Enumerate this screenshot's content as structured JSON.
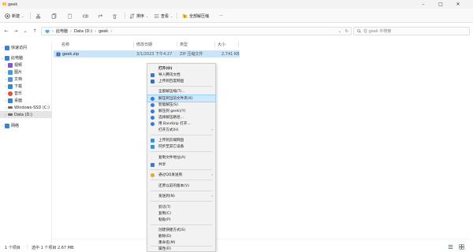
{
  "window": {
    "title": "geek"
  },
  "toolbar": {
    "new_label": "新建",
    "sort_label": "排序",
    "view_label": "查看",
    "extract_all_label": "全部解压缩",
    "more_label": "···"
  },
  "address": {
    "path": [
      "此电脑",
      "Data (D:)",
      "geek"
    ],
    "search_placeholder": "在 geek 中搜索"
  },
  "nav": {
    "items": [
      {
        "label": "快速访问",
        "color": "#3b82d6"
      },
      {
        "label": "此电脑",
        "color": "#3b82d6"
      },
      {
        "label": "视频",
        "color": "#7b5cd6"
      },
      {
        "label": "图片",
        "color": "#3aa0d8"
      },
      {
        "label": "文档",
        "color": "#5b8dd6"
      },
      {
        "label": "下载",
        "color": "#2f8ad6"
      },
      {
        "label": "音乐",
        "color": "#e0533b"
      },
      {
        "label": "桌面",
        "color": "#3a7fd6"
      },
      {
        "label": "Windows-SSD (C:)",
        "color": "#6b6b6b"
      },
      {
        "label": "Data (D:)",
        "color": "#6b6b6b"
      },
      {
        "label": "网络",
        "color": "#3b82d6"
      }
    ]
  },
  "columns": {
    "name": "名称",
    "modified": "修改日期",
    "type": "类型",
    "size": "大小"
  },
  "file": {
    "name": "geek.zip",
    "modified": "3/1/2023 下午4:27",
    "type": "ZIP 压缩文件",
    "size": "2,741 KB"
  },
  "context_menu": {
    "items": [
      {
        "label": "打开(O)",
        "bold": true
      },
      {
        "label": "导入腾讯文档",
        "icon_color": "#2f7be0"
      },
      {
        "label": "上传到百度网盘",
        "icon_color": "#2b6fd6"
      },
      {
        "label": "全部解压缩(T)..."
      },
      {
        "label": "解压到当前文件夹(X)",
        "icon_color": "#2f7be0",
        "highlight": true
      },
      {
        "label": "智能解压(S)",
        "icon_color": "#2f7be0"
      },
      {
        "label": "解压到 geek\\(Y)",
        "icon_color": "#2f7be0"
      },
      {
        "label": "选择解压路径...",
        "icon_color": "#2f7be0"
      },
      {
        "label": "用 Bandizip 打开...",
        "icon_color": "#2f7be0"
      },
      {
        "label": "打开方式(H)",
        "arrow": true
      },
      {
        "label": "上传到云端网盘",
        "icon_color": "#3b8fe0"
      },
      {
        "label": "同步至其它设备",
        "icon_color": "#3b8fe0"
      },
      {
        "label": "复制文件地址(A)"
      },
      {
        "label": "共享",
        "icon_color": "#2f7be0"
      },
      {
        "label": "通过QQ发送到",
        "icon_color": "#e8a62a",
        "arrow": true
      },
      {
        "label": "还原以前的版本(V)"
      },
      {
        "label": "发送到(N)",
        "arrow": true
      },
      {
        "label": "剪切(T)"
      },
      {
        "label": "复制(C)"
      },
      {
        "label": "粘贴(P)"
      },
      {
        "label": "创建快捷方式(S)"
      },
      {
        "label": "删除(D)"
      },
      {
        "label": "重命名(M)"
      },
      {
        "label": "属性(R)"
      }
    ]
  },
  "status": {
    "count": "1 个项目",
    "selected": "选中 1 个项目 2.67 MB"
  },
  "colors": {
    "accent": "#0067c0",
    "selection": "#cce4f7",
    "highlight": "#cde8ff"
  }
}
